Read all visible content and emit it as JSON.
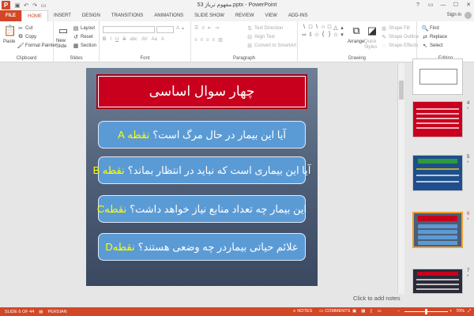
{
  "titlebar": {
    "title": "مفهوم تریاژ 53.pptx - PowerPoint",
    "app_icon": "P",
    "qat": [
      "save-icon",
      "undo-icon",
      "redo-icon",
      "start-show-icon"
    ],
    "window_controls": [
      "?",
      "▭",
      "—",
      "☐",
      "✕"
    ]
  },
  "tabs": [
    "FILE",
    "HOME",
    "INSERT",
    "DESIGN",
    "TRANSITIONS",
    "ANIMATIONS",
    "SLIDE SHOW",
    "REVIEW",
    "VIEW",
    "ADD-INS"
  ],
  "active_tab": "HOME",
  "account": {
    "sign_in": "Sign in"
  },
  "ribbon": {
    "clipboard": {
      "label": "Clipboard",
      "paste": "Paste",
      "cut": "Cut",
      "copy": "Copy",
      "format_painter": "Format Painter"
    },
    "slides": {
      "label": "Slides",
      "new_slide": "New Slide",
      "layout": "Layout",
      "reset": "Reset",
      "section": "Section"
    },
    "font": {
      "label": "Font"
    },
    "paragraph": {
      "label": "Paragraph",
      "text_direction": "Text Direction",
      "align_text": "Align Text",
      "convert": "Convert to SmartArt"
    },
    "drawing": {
      "label": "Drawing",
      "arrange": "Arrange",
      "quick_styles": "Quick Styles",
      "shape_fill": "Shape Fill",
      "shape_outline": "Shape Outline",
      "shape_effects": "Shape Effects"
    },
    "editing": {
      "label": "Editing",
      "find": "Find",
      "replace": "Replace",
      "select": "Select"
    }
  },
  "slide": {
    "title": "چهار سوال اساسی",
    "bullets": [
      {
        "text": "آیا این بیمار در حال مرگ است؟",
        "tag": "نقطه A"
      },
      {
        "text": "آیا این بیماری است که نباید در انتظار بماند؟",
        "tag": "نقطه B"
      },
      {
        "text": "این بیمار چه تعداد منابع نیاز خواهد داشت؟",
        "tag": "نقطهC"
      },
      {
        "text": "علائم حیاتی بیماردر چه وضعی هستند؟",
        "tag": "نقطهD"
      }
    ],
    "colors": {
      "title_bg": "#c8001e",
      "bullet_bg": "#5b9bd5",
      "tag": "#ffff00"
    }
  },
  "notes_hint": "Click to add notes",
  "thumbnails": [
    {
      "num": "",
      "star": ""
    },
    {
      "num": "4",
      "star": "*"
    },
    {
      "num": "5",
      "star": "*"
    },
    {
      "num": "6",
      "star": "*"
    },
    {
      "num": "7",
      "star": "*"
    }
  ],
  "status": {
    "slide_info": "SLIDE 6 OF 44",
    "language": "PERSIAN",
    "notes": "NOTES",
    "comments": "COMMENTS",
    "zoom": "70%"
  }
}
